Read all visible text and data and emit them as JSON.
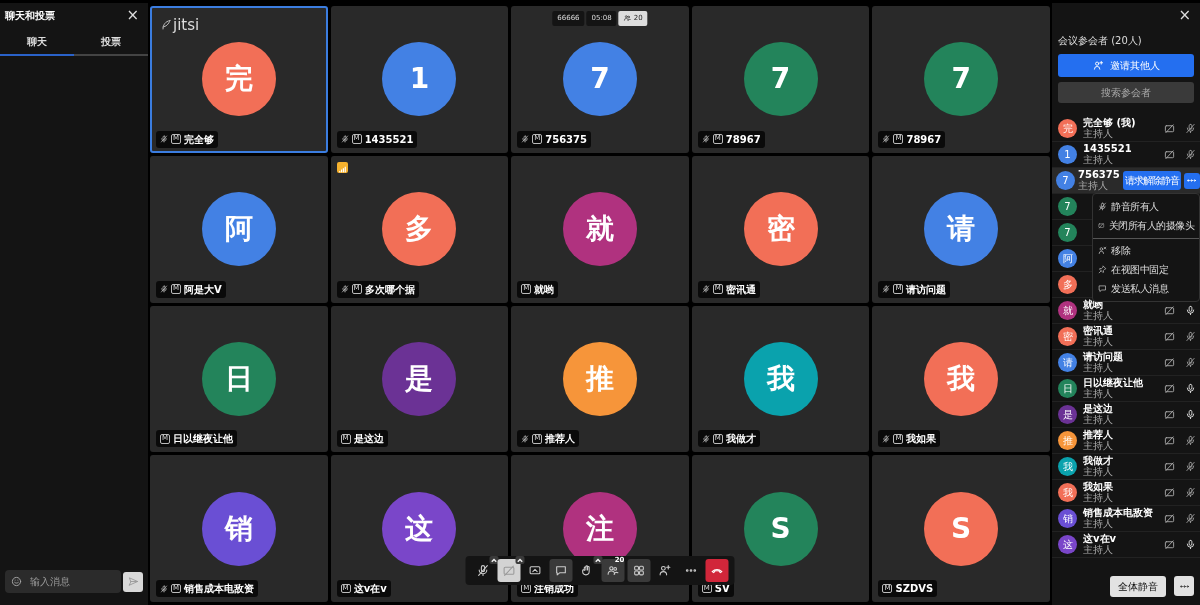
{
  "chat_panel": {
    "title": "聊天和投票",
    "close": "×",
    "tabs": [
      {
        "label": "聊天",
        "selected": true
      },
      {
        "label": "投票",
        "selected": false
      }
    ],
    "input": {
      "placeholder": "输入消息"
    }
  },
  "conference": {
    "logo": "jitsi",
    "room_name": "66666",
    "timer": "05:08",
    "participant_count": "20"
  },
  "tiles": [
    {
      "initial": "完",
      "color": "#f26f57",
      "name": "完全够",
      "muted": true,
      "selected": true,
      "weak_connection": false,
      "moderator_mark": "M"
    },
    {
      "initial": "1",
      "color": "#4381e4",
      "name": "1435521",
      "muted": true,
      "selected": false,
      "weak_connection": false,
      "moderator_mark": "M"
    },
    {
      "initial": "7",
      "color": "#4381e4",
      "name": "756375",
      "muted": true,
      "selected": false,
      "weak_connection": false,
      "moderator_mark": "M"
    },
    {
      "initial": "7",
      "color": "#23845b",
      "name": "78967",
      "muted": true,
      "selected": false,
      "weak_connection": false,
      "moderator_mark": "M"
    },
    {
      "initial": "7",
      "color": "#23845b",
      "name": "78967",
      "muted": true,
      "selected": false,
      "weak_connection": false,
      "moderator_mark": "M"
    },
    {
      "initial": "阿",
      "color": "#4381e4",
      "name": "阿是大V",
      "muted": true,
      "selected": false,
      "weak_connection": false,
      "moderator_mark": "M"
    },
    {
      "initial": "多",
      "color": "#f26f57",
      "name": "多次哪个据",
      "muted": true,
      "selected": false,
      "weak_connection": true,
      "moderator_mark": "M"
    },
    {
      "initial": "就",
      "color": "#b0327f",
      "name": "就哟",
      "muted": false,
      "selected": false,
      "weak_connection": false,
      "moderator_mark": "M"
    },
    {
      "initial": "密",
      "color": "#f26f57",
      "name": "密讯通",
      "muted": true,
      "selected": false,
      "weak_connection": false,
      "moderator_mark": "M"
    },
    {
      "initial": "请",
      "color": "#4381e4",
      "name": "请访问题",
      "muted": true,
      "selected": false,
      "weak_connection": false,
      "moderator_mark": "M"
    },
    {
      "initial": "日",
      "color": "#23845b",
      "name": "日以继夜让他",
      "muted": false,
      "selected": false,
      "weak_connection": false,
      "moderator_mark": "M"
    },
    {
      "initial": "是",
      "color": "#6b3295",
      "name": "是这边",
      "muted": false,
      "selected": false,
      "weak_connection": false,
      "moderator_mark": "M"
    },
    {
      "initial": "推",
      "color": "#f6953a",
      "name": "推荐人",
      "muted": true,
      "selected": false,
      "weak_connection": false,
      "moderator_mark": "M"
    },
    {
      "initial": "我",
      "color": "#0aa2ad",
      "name": "我做才",
      "muted": true,
      "selected": false,
      "weak_connection": false,
      "moderator_mark": "M"
    },
    {
      "initial": "我",
      "color": "#f26f57",
      "name": "我如果",
      "muted": true,
      "selected": false,
      "weak_connection": false,
      "moderator_mark": "M"
    },
    {
      "initial": "销",
      "color": "#6a4fd4",
      "name": "销售成本电敌资",
      "muted": true,
      "selected": false,
      "weak_connection": false,
      "moderator_mark": "M"
    },
    {
      "initial": "这",
      "color": "#7a46c9",
      "name": "这v在v",
      "muted": false,
      "selected": false,
      "weak_connection": false,
      "moderator_mark": "M"
    },
    {
      "initial": "注",
      "color": "#b0327f",
      "name": "注销成功",
      "muted": false,
      "selected": false,
      "weak_connection": false,
      "moderator_mark": "M"
    },
    {
      "initial": "S",
      "color": "#23845b",
      "name": "SV",
      "muted": false,
      "selected": false,
      "weak_connection": false,
      "moderator_mark": "M"
    },
    {
      "initial": "S",
      "color": "#f26f57",
      "name": "SZDVS",
      "muted": false,
      "selected": false,
      "weak_connection": false,
      "moderator_mark": "M"
    }
  ],
  "toolbar": [
    {
      "kind": "mic",
      "toggled": false,
      "caret": true
    },
    {
      "kind": "camera",
      "toggled": true,
      "caret": true
    },
    {
      "kind": "screen",
      "toggled": false,
      "caret": false
    },
    {
      "kind": "chat",
      "toggled": true,
      "caret": false
    },
    {
      "kind": "hand",
      "toggled": false,
      "caret": true
    },
    {
      "kind": "participants",
      "toggled": true,
      "caret": false,
      "badge": "20"
    },
    {
      "kind": "tiles",
      "toggled": true,
      "caret": false
    },
    {
      "kind": "invite",
      "toggled": false,
      "caret": false
    },
    {
      "kind": "more",
      "toggled": false,
      "caret": false
    },
    {
      "kind": "hangup",
      "caret": false
    }
  ],
  "participants_panel": {
    "close": "×",
    "title": "会议参会者 (20人)",
    "invite_button": "邀请其他人",
    "search_placeholder": "搜索参会者",
    "row_action": "请求解除静音",
    "participants": [
      {
        "initial": "完",
        "color": "#f26f57",
        "name": "完全够 (我)",
        "role": "主持人",
        "selected": false,
        "muted": true
      },
      {
        "initial": "1",
        "color": "#4381e4",
        "name": "1435521",
        "role": "主持人",
        "selected": false,
        "muted": true
      },
      {
        "initial": "7",
        "color": "#4381e4",
        "name": "756375",
        "role": "主持人",
        "selected": true
      },
      {
        "initial": "7",
        "color": "#23845b",
        "selected": false
      },
      {
        "initial": "7",
        "color": "#23845b",
        "selected": false
      },
      {
        "initial": "阿",
        "color": "#4381e4",
        "selected": false
      },
      {
        "initial": "多",
        "color": "#f26f57",
        "selected": false
      },
      {
        "initial": "就",
        "color": "#b0327f",
        "name": "就哟",
        "role": "主持人",
        "selected": false,
        "muted": false
      },
      {
        "initial": "密",
        "color": "#f26f57",
        "name": "密讯通",
        "role": "主持人",
        "selected": false,
        "muted": true
      },
      {
        "initial": "请",
        "color": "#4381e4",
        "name": "请访问题",
        "role": "主持人",
        "selected": false,
        "muted": true
      },
      {
        "initial": "日",
        "color": "#23845b",
        "name": "日以继夜让他",
        "role": "主持人",
        "selected": false,
        "muted": false
      },
      {
        "initial": "是",
        "color": "#6b3295",
        "name": "是这边",
        "role": "主持人",
        "selected": false,
        "muted": false
      },
      {
        "initial": "推",
        "color": "#f6953a",
        "name": "推荐人",
        "role": "主持人",
        "selected": false,
        "muted": true
      },
      {
        "initial": "我",
        "color": "#0aa2ad",
        "name": "我做才",
        "role": "主持人",
        "selected": false,
        "muted": true
      },
      {
        "initial": "我",
        "color": "#f26f57",
        "name": "我如果",
        "role": "主持人",
        "selected": false,
        "muted": true
      },
      {
        "initial": "销",
        "color": "#6a4fd4",
        "name": "销售成本电敌资",
        "role": "主持人",
        "selected": false,
        "muted": true
      },
      {
        "initial": "这",
        "color": "#7a46c9",
        "name": "这v在v",
        "role": "主持人",
        "selected": false,
        "muted": false
      }
    ],
    "menu": [
      {
        "kind": "mute",
        "label": "静音所有人"
      },
      {
        "kind": "camera",
        "label": "关闭所有人的摄像头"
      },
      {
        "kind": "remove",
        "label": "移除"
      },
      {
        "kind": "pin",
        "label": "在视图中固定"
      },
      {
        "kind": "message",
        "label": "发送私人消息"
      }
    ],
    "mute_all_button": "全体静音"
  }
}
